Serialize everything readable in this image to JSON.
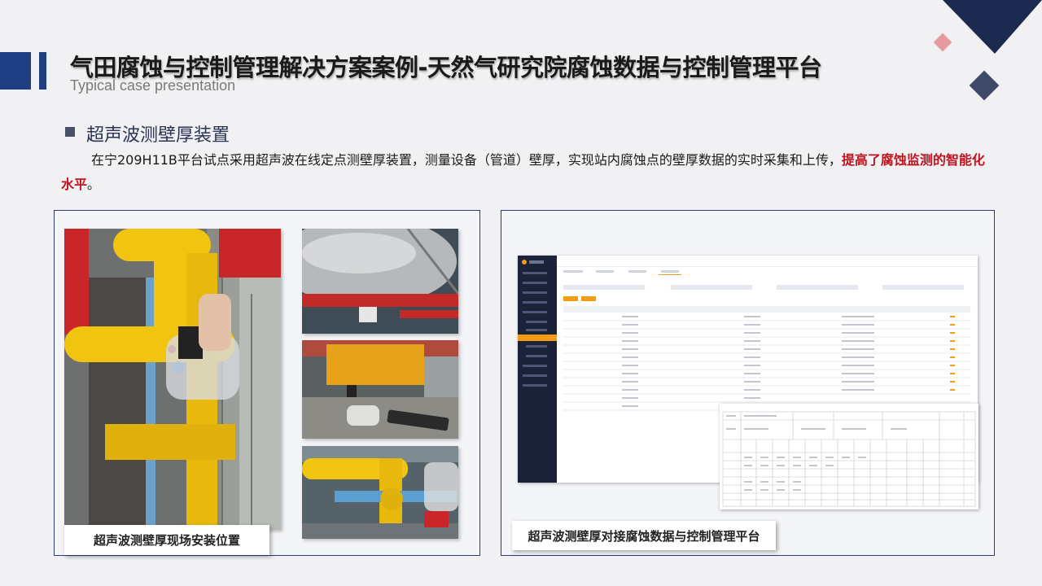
{
  "header": {
    "title": "气田腐蚀与控制管理解决方案案例-天然气研究院腐蚀数据与控制管理平台",
    "subtitle": "Typical case presentation"
  },
  "section": {
    "title": "超声波测壁厚装置",
    "body_normal": "在宁209H11B平台试点采用超声波在线定点测壁厚装置，测量设备（管道）壁厚，实现站内腐蚀点的壁厚数据的实时采集和上传，",
    "body_highlight": "提高了腐蚀监测的智能化水平",
    "body_end": "。"
  },
  "panels": {
    "left_caption": "超声波测壁厚现场安装位置",
    "right_caption": "超声波测壁厚对接腐蚀数据与控制管理平台"
  },
  "colors": {
    "accent_navy": "#1e3f82",
    "highlight_red": "#c0121e",
    "panel_border": "#2a3a7a"
  }
}
